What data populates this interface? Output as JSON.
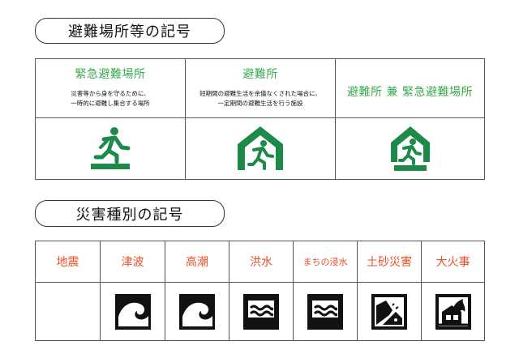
{
  "sections": {
    "shelter_heading": "避難場所等の記号",
    "hazard_heading": "災害種別の記号"
  },
  "shelters": [
    {
      "title": "緊急避難場所",
      "desc_line1": "災害等から身を守るために、",
      "desc_line2": "一時的に避難し集合する場所",
      "icon": "running-person-emergency-icon"
    },
    {
      "title": "避難所",
      "desc_line1": "短期間の避難生活を余儀なくされた場合に、",
      "desc_line2": "一定期間の避難生活を行う施設",
      "icon": "shelter-house-icon"
    },
    {
      "title": "避難所 兼 緊急避難場所",
      "icon": "shelter-emergency-combined-icon"
    }
  ],
  "hazards": [
    {
      "label": "地震",
      "icon": ""
    },
    {
      "label": "津波",
      "icon": "tsunami-icon"
    },
    {
      "label": "高潮",
      "icon": "storm-surge-icon"
    },
    {
      "label": "洪水",
      "icon": "flood-icon"
    },
    {
      "label": "まちの浸水",
      "icon": "inland-flood-icon"
    },
    {
      "label": "土砂災害",
      "icon": "landslide-icon"
    },
    {
      "label": "大火事",
      "icon": "large-fire-icon"
    }
  ],
  "colors": {
    "shelter_green": "#3aaa50",
    "icon_green": "#1e8a4a",
    "hazard_orange": "#e8502a",
    "border": "#555555"
  }
}
